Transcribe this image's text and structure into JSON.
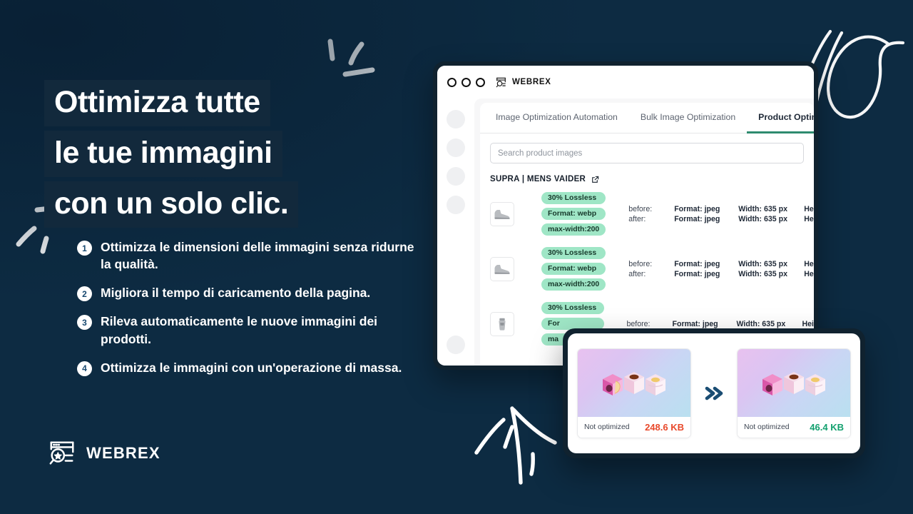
{
  "theme": {
    "bg_dark": "#0b2740",
    "bg_light": "#1e5f91",
    "highlight_box": "#12293c",
    "badge_bg": "#9fe6c6",
    "accent_green": "#2e8b6f",
    "size_bad": "#e8482a",
    "size_good": "#12a06e"
  },
  "headline": {
    "lines": [
      "Ottimizza tutte",
      "le tue immagini",
      "con un solo clic."
    ]
  },
  "bullets": [
    {
      "num": "1",
      "text": "Ottimizza le dimensioni delle immagini senza ridurne la qualità."
    },
    {
      "num": "2",
      "text": "Migliora il tempo di caricamento della pagina."
    },
    {
      "num": "3",
      "text": "Rileva automaticamente le nuove immagini dei prodotti."
    },
    {
      "num": "4",
      "text": "Ottimizza le immagini con un'operazione di massa."
    }
  ],
  "brand": {
    "name": "WEBREX",
    "mark_icon": "webrex-search-star-icon"
  },
  "browser": {
    "titlebar": {
      "dots": [
        "window-dot-1",
        "window-dot-2",
        "window-dot-3"
      ],
      "app_name": "WEBREX",
      "app_icon": "webrex-search-star-icon"
    },
    "sidebar": {
      "placeholders": [
        "nav-placeholder-1",
        "nav-placeholder-2",
        "nav-placeholder-3",
        "nav-placeholder-4"
      ],
      "bottom_placeholder": "nav-placeholder-bottom"
    },
    "tabs": [
      {
        "label": "Image Optimization Automation",
        "active": false
      },
      {
        "label": "Bulk Image Optimization",
        "active": false
      },
      {
        "label": "Product Optimized Im",
        "active": true
      }
    ],
    "search": {
      "placeholder": "Search product images",
      "value": ""
    },
    "product": {
      "title": "SUPRA | MENS VAIDER",
      "external_link_icon": "external-link-icon"
    },
    "rows": [
      {
        "thumb_icon": "sneaker-thumbnail",
        "badges": [
          "30% Lossless",
          "Format: webp",
          "max-width:200"
        ],
        "metrics": [
          {
            "stage": "before:",
            "format": "Format: jpeg",
            "width": "Width: 635 px",
            "height": "Hei"
          },
          {
            "stage": "after:",
            "format": "Format: jpeg",
            "width": "Width: 635 px",
            "height": "Hei"
          }
        ]
      },
      {
        "thumb_icon": "sneaker-thumbnail",
        "badges": [
          "30% Lossless",
          "Format: webp",
          "max-width:200"
        ],
        "metrics": [
          {
            "stage": "before:",
            "format": "Format: jpeg",
            "width": "Width: 635 px",
            "height": "Hei"
          },
          {
            "stage": "after:",
            "format": "Format: jpeg",
            "width": "Width: 635 px",
            "height": "Hei"
          }
        ]
      },
      {
        "thumb_icon": "shoe-thumbnail",
        "badges": [
          "30% Lossless",
          "For",
          "ma"
        ],
        "metrics": [
          {
            "stage": "before:",
            "format": "Format: jpeg",
            "width": "Width: 635 px",
            "height": "Hei"
          },
          {
            "stage": "",
            "format": "",
            "width": "",
            "height": ""
          }
        ]
      }
    ]
  },
  "compare": {
    "arrow_icon": "double-chevron-right-icon",
    "before": {
      "label": "Not optimized",
      "size": "248.6 KB",
      "image_icon": "gift-boxes-3d-image"
    },
    "after": {
      "label": "Not optimized",
      "size": "46.4 KB",
      "image_icon": "gift-boxes-3d-image"
    }
  }
}
